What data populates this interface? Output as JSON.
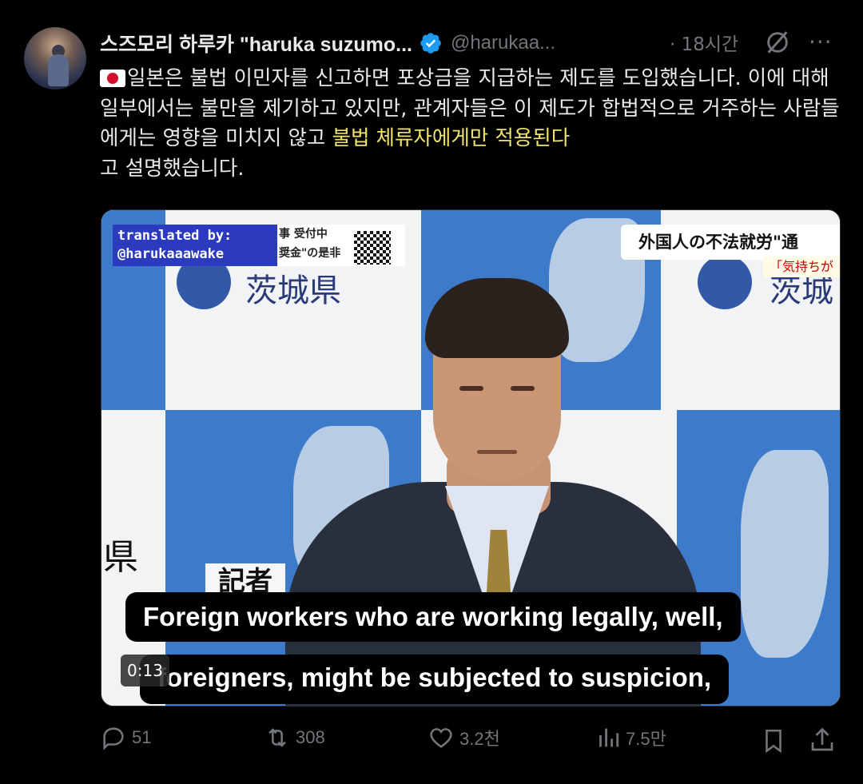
{
  "author": {
    "display_name": "스즈모리 하루카 \"haruka suzumo...",
    "handle": "@harukaa...",
    "verified": true,
    "time_ago": "· 18시간"
  },
  "tweet": {
    "flag_icon": "japan-flag-icon",
    "text_main": "일본은 불법 이민자를 신고하면 포상금을 지급하는 제도를 도입했습니다. 이에 대해 일부에서는 불만을 제기하고 있지만, 관계자들은 이 제도가 합법적으로 거주하는 사람들에게는 영향을 미치지 않고 ",
    "text_highlight": "불법 체류자에게만 적용된다",
    "text_end": "고 설명했습니다.",
    "highlight_color": "#f0e36a"
  },
  "video": {
    "translated_by": "translated by:",
    "translator_handle": "@harukaaawake",
    "banner_left_1": "事 受付中",
    "banner_left_2": "奨金\"の是非",
    "big_kanji_left": "茨城県",
    "banner_right": "外国人の不法就労\"通",
    "banner_right_sub": "「気持ちが",
    "big_kanji_right": "茨城",
    "ken_label": "県",
    "reporter_label": "記者",
    "subtitle_line1": "Foreign workers who are working legally, well,",
    "subtitle_line2": "foreigners, might be subjected to suspicion,",
    "timestamp": "0:13"
  },
  "actions": {
    "replies": "51",
    "reposts": "308",
    "likes": "3.2천",
    "views": "7.5만"
  }
}
